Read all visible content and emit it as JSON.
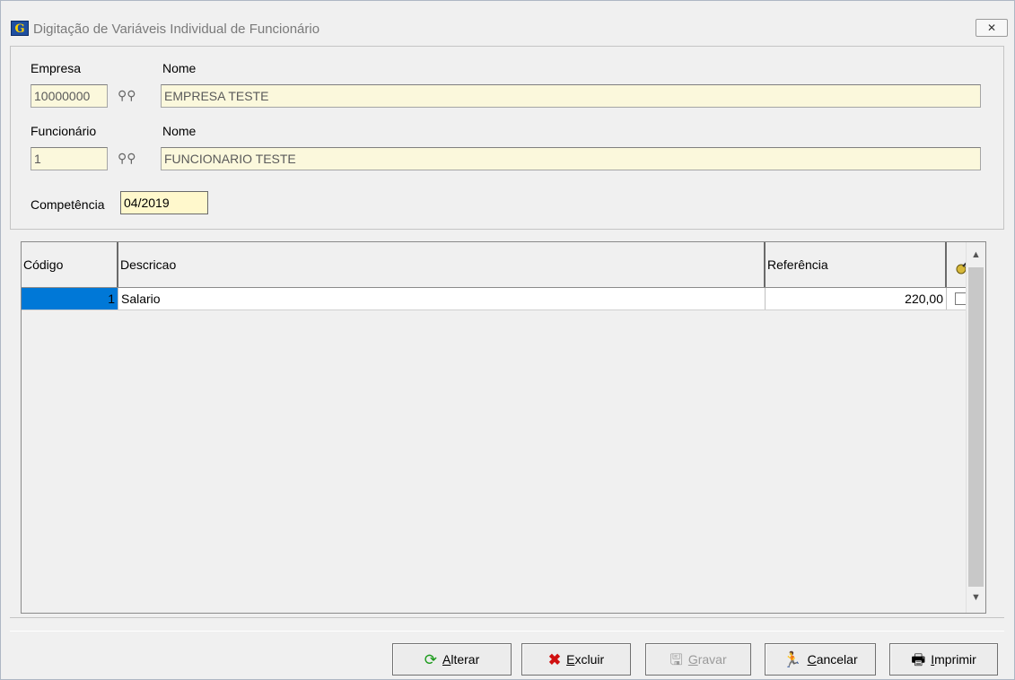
{
  "window": {
    "title": "Digitação de Variáveis Individual de Funcionário",
    "close_glyph": "✕"
  },
  "form": {
    "empresa": {
      "label": "Empresa",
      "value": "10000000"
    },
    "empresa_nome": {
      "label": "Nome",
      "value": "EMPRESA TESTE"
    },
    "funcionario": {
      "label": "Funcionário",
      "value": "1"
    },
    "funcionario_nome": {
      "label": "Nome",
      "value": "FUNCIONARIO TESTE"
    },
    "competencia": {
      "label": "Competência",
      "value": "04/2019"
    }
  },
  "grid": {
    "columns": [
      "Código",
      "Descricao",
      "Referência"
    ],
    "rows": [
      {
        "codigo": "1",
        "descricao": "Salario",
        "referencia": "220,00",
        "checked": false
      }
    ]
  },
  "buttons": {
    "alterar": {
      "first": "A",
      "rest": "lterar"
    },
    "excluir": {
      "first": "E",
      "rest": "xcluir"
    },
    "gravar": {
      "first": "G",
      "rest": "ravar"
    },
    "cancelar": {
      "first": "C",
      "rest": "ancelar"
    },
    "imprimir": {
      "first": "I",
      "rest": "mprimir"
    }
  },
  "colors": {
    "selection": "#0078d7",
    "field_bg": "#fbf8dc"
  }
}
